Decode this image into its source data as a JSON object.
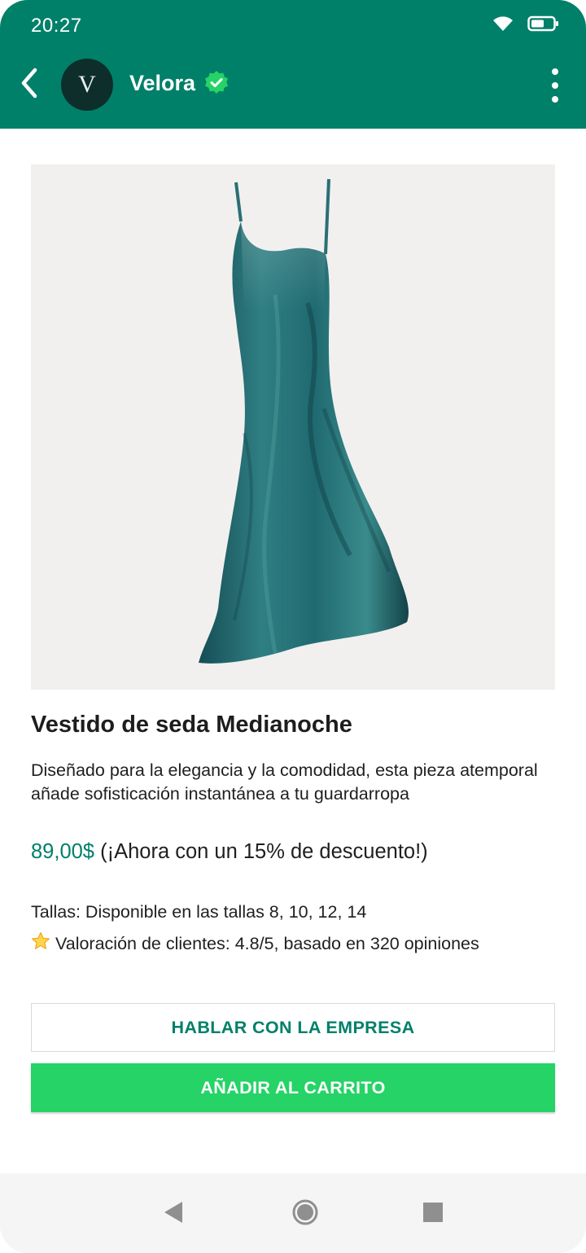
{
  "status_bar": {
    "time": "20:27",
    "icons": [
      "wifi-icon",
      "battery-icon"
    ]
  },
  "header": {
    "avatar_letter": "V",
    "business_name": "Velora",
    "verified_icon": "verified-check-icon",
    "menu_icon": "more-vert-icon",
    "back_icon": "back-arrow-icon"
  },
  "product": {
    "image_subject": "teal silk slip dress",
    "title": "Vestido de seda Medianoche",
    "description": "Diseñado para la elegancia y la comodidad, esta pieza atemporal añade sofisticación instantánea a tu guardarropa",
    "price": "89,00$",
    "discount_text": "(¡Ahora con un 15% de descuento!)",
    "sizes": "Tallas: Disponible en las tallas 8, 10, 12, 14",
    "rating_icon": "star-icon",
    "rating_text": "Valoración de clientes: 4.8/5, basado en 320 opiniones"
  },
  "actions": {
    "contact_label": "HABLAR CON LA EMPRESA",
    "add_to_cart_label": "AÑADIR AL CARRITO"
  },
  "nav": {
    "back_icon": "nav-back-icon",
    "home_icon": "nav-home-icon",
    "recent_icon": "nav-recent-icon"
  },
  "colors": {
    "header_bg": "#008069",
    "price": "#008069",
    "primary_button": "#25d366",
    "avatar_bg": "#0d2e2b",
    "verified_badge": "#25d366"
  }
}
